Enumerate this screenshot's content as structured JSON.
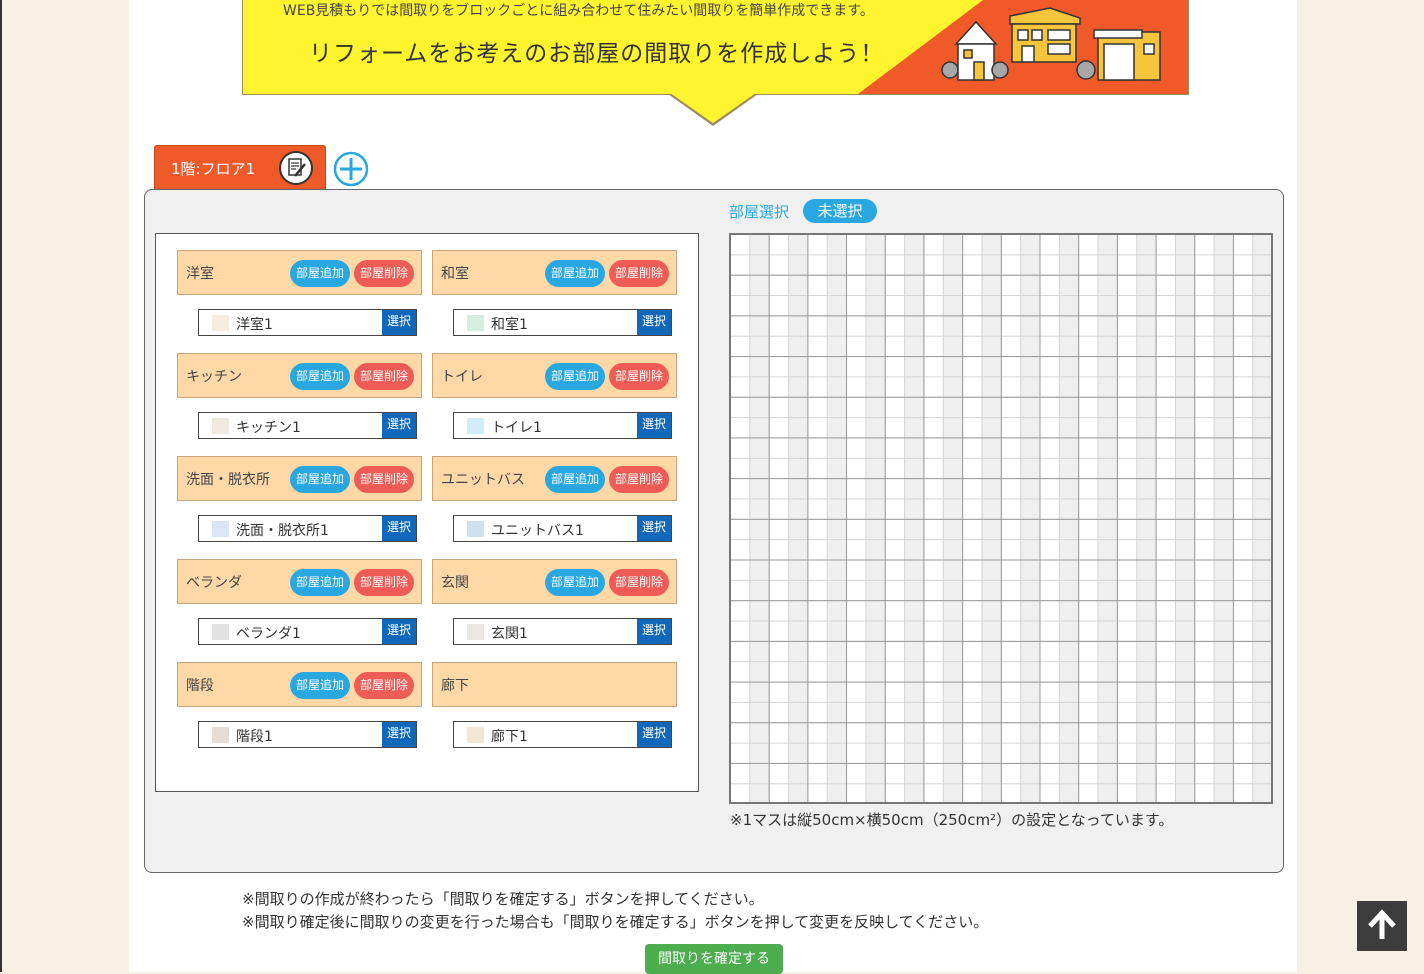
{
  "banner": {
    "subtitle": "WEB見積もりでは間取りをブロックごとに組み合わせて住みたい間取りを簡単作成できます。",
    "title": "リフォームをお考えのお部屋の間取りを作成しよう！"
  },
  "floor_tab": {
    "label": "1階:フロア1"
  },
  "room_categories": [
    {
      "name": "洋室",
      "add_label": "部屋追加",
      "del_label": "部屋削除",
      "room": "洋室1",
      "swatch": "#f7ece0",
      "select_label": "選択"
    },
    {
      "name": "和室",
      "add_label": "部屋追加",
      "del_label": "部屋削除",
      "room": "和室1",
      "swatch": "#d6ece0",
      "select_label": "選択"
    },
    {
      "name": "キッチン",
      "add_label": "部屋追加",
      "del_label": "部屋削除",
      "room": "キッチン1",
      "swatch": "#efe9e2",
      "select_label": "選択"
    },
    {
      "name": "トイレ",
      "add_label": "部屋追加",
      "del_label": "部屋削除",
      "room": "トイレ1",
      "swatch": "#d2ecf8",
      "select_label": "選択"
    },
    {
      "name": "洗面・脱衣所",
      "add_label": "部屋追加",
      "del_label": "部屋削除",
      "room": "洗面・脱衣所1",
      "swatch": "#dae6f5",
      "select_label": "選択"
    },
    {
      "name": "ユニットバス",
      "add_label": "部屋追加",
      "del_label": "部屋削除",
      "room": "ユニットバス1",
      "swatch": "#cfe0f1",
      "select_label": "選択"
    },
    {
      "name": "ベランダ",
      "add_label": "部屋追加",
      "del_label": "部屋削除",
      "room": "ベランダ1",
      "swatch": "#e2e2e2",
      "select_label": "選択"
    },
    {
      "name": "玄関",
      "add_label": "部屋追加",
      "del_label": "部屋削除",
      "room": "玄関1",
      "swatch": "#ebe7e0",
      "select_label": "選択"
    },
    {
      "name": "階段",
      "add_label": "部屋追加",
      "del_label": "部屋削除",
      "room": "階段1",
      "swatch": "#e7dcd3",
      "select_label": "選択"
    },
    {
      "name": "廊下",
      "room": "廊下1",
      "swatch": "#f4e6d4",
      "select_label": "選択"
    }
  ],
  "room_select": {
    "label": "部屋選択",
    "status": "未選択"
  },
  "grid_note": "※1マスは縦50cm×横50cm（250cm²）の設定となっています。",
  "footer": {
    "note1": "※間取りの作成が終わったら「間取りを確定する」ボタンを押してください。",
    "note2": "※間取り確定後に間取りの変更を行った場合も「間取りを確定する」ボタンを押して変更を反映してください。",
    "confirm_label": "間取りを確定する"
  },
  "colors": {
    "accent_orange": "#f05a28",
    "banner_yellow": "#fff42e",
    "category_bg": "#ffd8a8",
    "add_blue": "#29a7e1",
    "delete_red": "#ef5b55",
    "select_blue": "#1167b9",
    "confirm_green": "#4cae4f"
  },
  "icons": {
    "floor_edit": "edit-document-icon",
    "add_floor": "plus-circle-icon",
    "page_top": "arrow-up-icon",
    "banner": "houses-illustration"
  }
}
